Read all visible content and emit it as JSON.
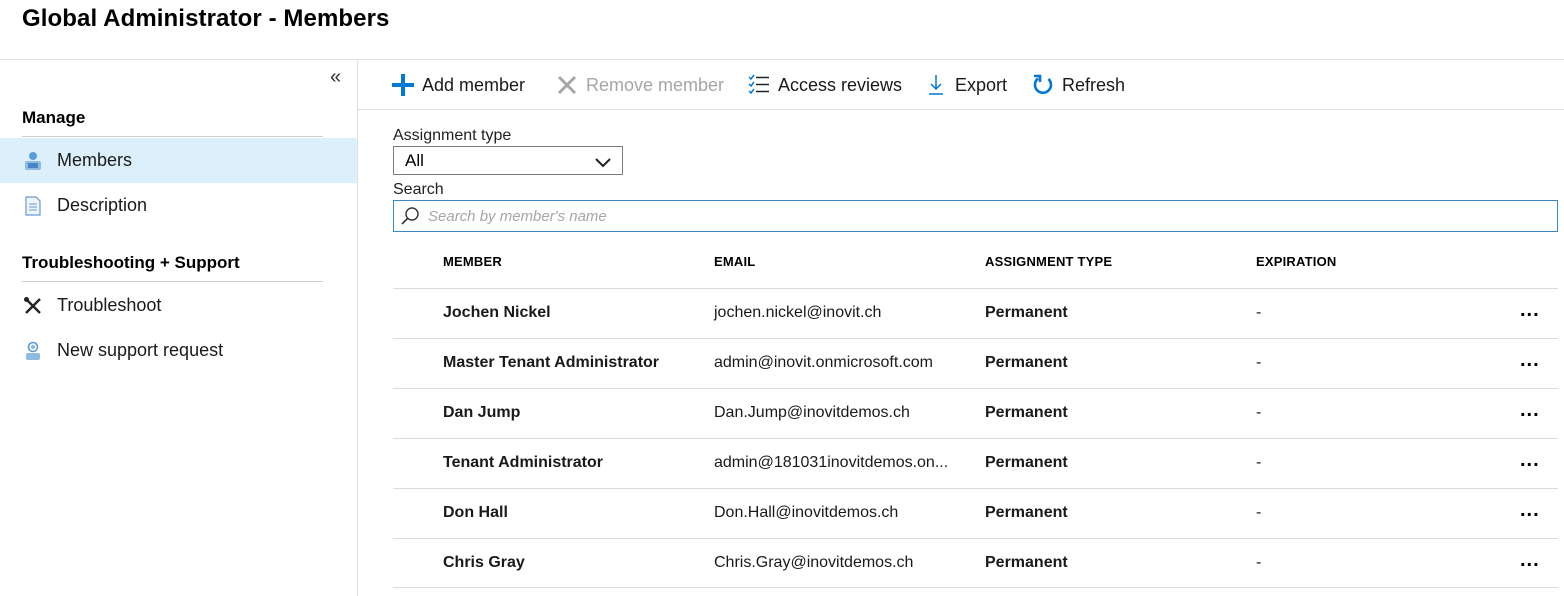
{
  "page": {
    "title": "Global Administrator - Members"
  },
  "sidebar": {
    "collapse_icon": "«",
    "sections": [
      {
        "label": "Manage"
      },
      {
        "label": "Troubleshooting + Support"
      }
    ],
    "items": [
      {
        "label": "Members",
        "icon": "members-icon"
      },
      {
        "label": "Description",
        "icon": "document-icon"
      },
      {
        "label": "Troubleshoot",
        "icon": "wrench-screwdriver-icon"
      },
      {
        "label": "New support request",
        "icon": "support-person-icon"
      }
    ]
  },
  "toolbar": {
    "add_member": "Add member",
    "remove_member": "Remove member",
    "access_reviews": "Access reviews",
    "export": "Export",
    "refresh": "Refresh"
  },
  "filters": {
    "assignment_type_label": "Assignment type",
    "assignment_type_value": "All",
    "search_label": "Search",
    "search_placeholder": "Search by member's name"
  },
  "table": {
    "columns": [
      "MEMBER",
      "EMAIL",
      "ASSIGNMENT TYPE",
      "EXPIRATION"
    ],
    "rows": [
      {
        "member": "Jochen Nickel",
        "email": "jochen.nickel@inovit.ch",
        "assignment": "Permanent",
        "expiration": "-"
      },
      {
        "member": "Master Tenant Administrator",
        "email": "admin@inovit.onmicrosoft.com",
        "assignment": "Permanent",
        "expiration": "-"
      },
      {
        "member": "Dan Jump",
        "email": "Dan.Jump@inovitdemos.ch",
        "assignment": "Permanent",
        "expiration": "-"
      },
      {
        "member": "Tenant Administrator",
        "email": "admin@181031inovitdemos.on...",
        "assignment": "Permanent",
        "expiration": "-"
      },
      {
        "member": "Don Hall",
        "email": "Don.Hall@inovitdemos.ch",
        "assignment": "Permanent",
        "expiration": "-"
      },
      {
        "member": "Chris Gray",
        "email": "Chris.Gray@inovitdemos.ch",
        "assignment": "Permanent",
        "expiration": "-"
      }
    ],
    "more_label": "..."
  },
  "colors": {
    "accent": "#0078d4",
    "selected_bg": "#dcf0fc",
    "disabled": "#a6a6a6"
  }
}
